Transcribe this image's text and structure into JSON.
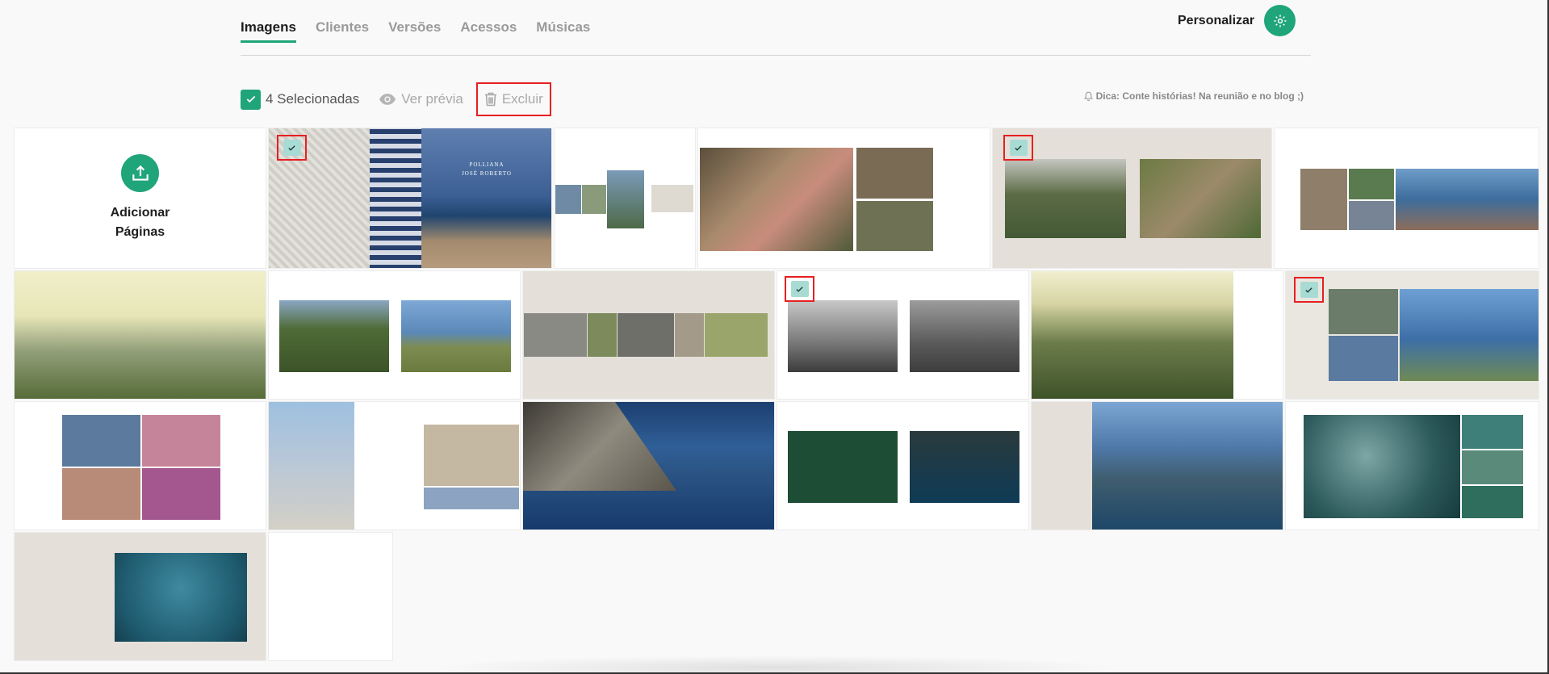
{
  "tabs": [
    {
      "label": "Imagens",
      "active": true
    },
    {
      "label": "Clientes",
      "active": false
    },
    {
      "label": "Versões",
      "active": false
    },
    {
      "label": "Acessos",
      "active": false
    },
    {
      "label": "Músicas",
      "active": false
    }
  ],
  "header": {
    "personalize_label": "Personalizar",
    "gear_icon": "gear-icon"
  },
  "toolbar": {
    "selected_label": "4 Selecionadas",
    "preview_label": "Ver prévia",
    "delete_label": "Excluir",
    "tip": "Dica: Conte histórias! Na reunião e no blog ;)"
  },
  "add_page": {
    "line1": "Adicionar",
    "line2": "Páginas"
  },
  "title_page": {
    "line1": "POLLIANA",
    "line2": "JOSÉ ROBERTO"
  },
  "colors": {
    "accent": "#1fa579",
    "highlight": "#e62020",
    "selected_check": "#a8dbd3"
  }
}
